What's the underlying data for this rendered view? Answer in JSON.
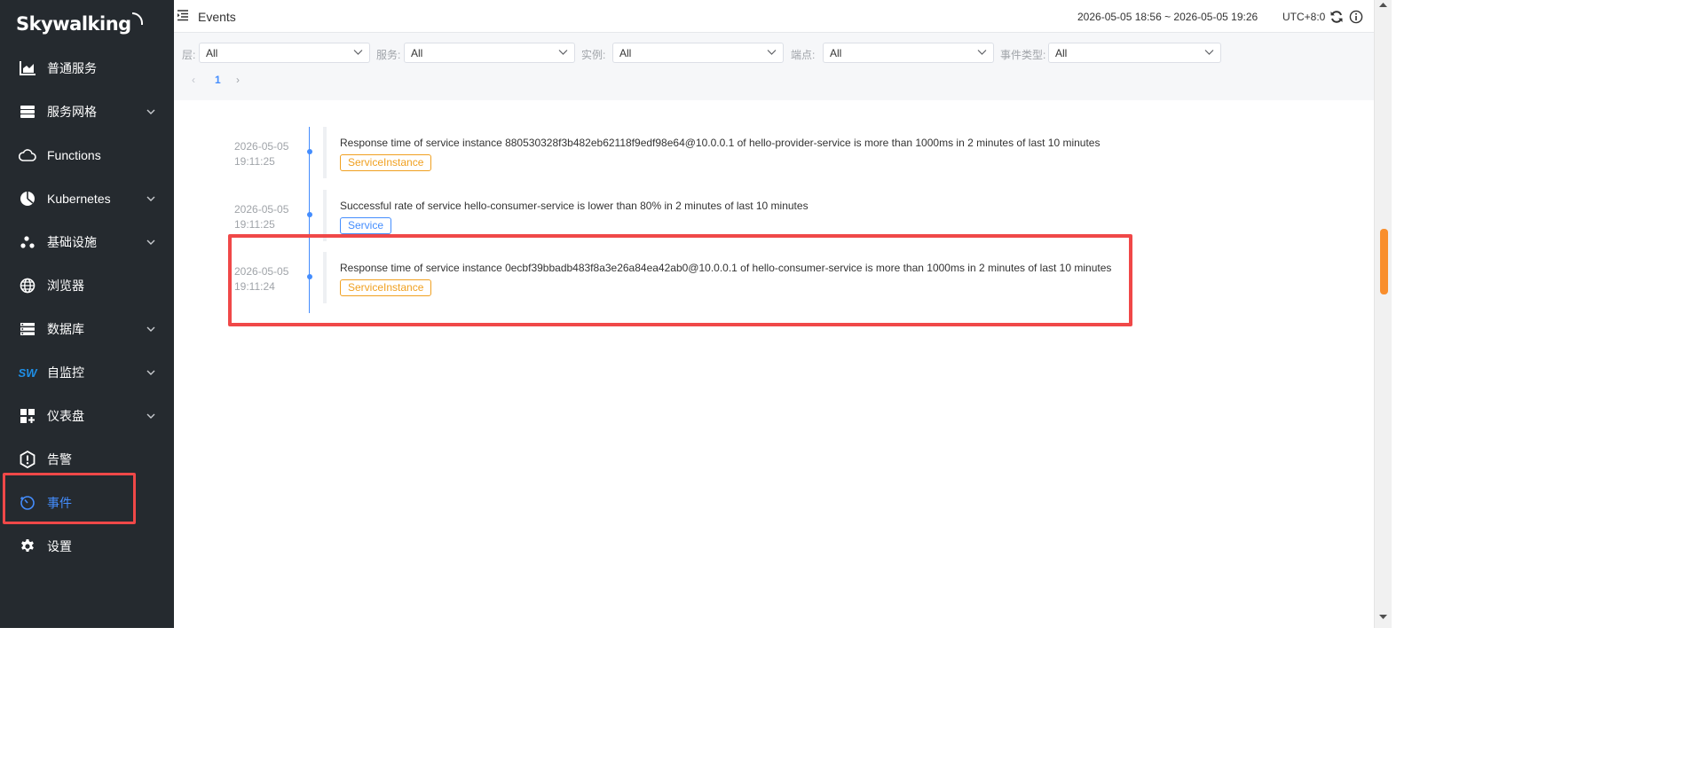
{
  "brand": {
    "logo_text": "Skywalking"
  },
  "sidebar": {
    "items": [
      {
        "label": "普通服务",
        "icon": "chart-icon",
        "has_submenu": false
      },
      {
        "label": "服务网格",
        "icon": "layers-icon",
        "has_submenu": true
      },
      {
        "label": "Functions",
        "icon": "cloud-icon",
        "has_submenu": false
      },
      {
        "label": "Kubernetes",
        "icon": "pie-icon",
        "has_submenu": true
      },
      {
        "label": "基础设施",
        "icon": "nodes-icon",
        "has_submenu": true
      },
      {
        "label": "浏览器",
        "icon": "globe-icon",
        "has_submenu": false
      },
      {
        "label": "数据库",
        "icon": "database-icon",
        "has_submenu": true
      },
      {
        "label": "自监控",
        "icon": "sw-logo-icon",
        "icon_text": "SW",
        "has_submenu": true
      },
      {
        "label": "仪表盘",
        "icon": "dashboard-icon",
        "has_submenu": true
      },
      {
        "label": "告警",
        "icon": "alert-hexagon-icon",
        "has_submenu": false
      },
      {
        "label": "事件",
        "icon": "timer-icon",
        "has_submenu": false,
        "active": true
      },
      {
        "label": "设置",
        "icon": "gear-icon",
        "has_submenu": false
      }
    ]
  },
  "header": {
    "title": "Events",
    "time_range": "2026-05-05 18:56 ~ 2026-05-05 19:26",
    "timezone": "UTC+8:0"
  },
  "filters": {
    "layer": {
      "label": "层:",
      "value": "All"
    },
    "service": {
      "label": "服务:",
      "value": "All"
    },
    "instance": {
      "label": "实例:",
      "value": "All"
    },
    "endpoint": {
      "label": "端点:",
      "value": "All"
    },
    "event_type": {
      "label": "事件类型:",
      "value": "All"
    }
  },
  "pagination": {
    "prev": "‹",
    "current": "1",
    "next": "›"
  },
  "events": [
    {
      "date": "2026-05-05",
      "time": "19:11:25",
      "message": "Response time of service instance 880530328f3b482eb62118f9edf98e64@10.0.0.1 of hello-provider-service is more than 1000ms in 2 minutes of last 10 minutes",
      "tag": "ServiceInstance"
    },
    {
      "date": "2026-05-05",
      "time": "19:11:25",
      "message": "Successful rate of service hello-consumer-service is lower than 80% in 2 minutes of last 10 minutes",
      "tag": "Service"
    },
    {
      "date": "2026-05-05",
      "time": "19:11:24",
      "message": "Response time of service instance 0ecbf39bbadb483f8a3e26a84ea42ab0@10.0.0.1 of hello-consumer-service is more than 1000ms in 2 minutes of last 10 minutes",
      "tag": "ServiceInstance"
    }
  ],
  "colors": {
    "sidebar_bg": "#252a2f",
    "accent": "#448dfe",
    "instance_tag": "#f0a020",
    "highlight": "#f04848",
    "scroll_thumb": "#f98e2c"
  }
}
